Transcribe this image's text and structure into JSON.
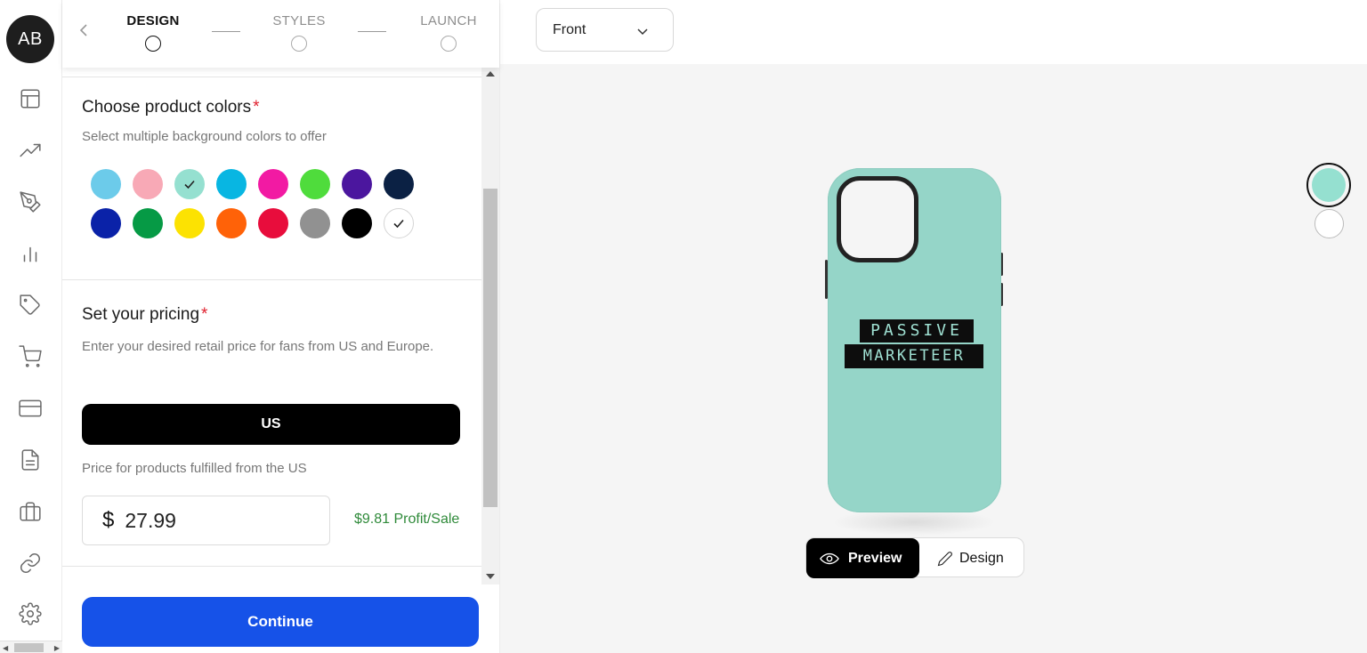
{
  "user": {
    "initials": "AB"
  },
  "nav": {
    "icons": [
      "layout-icon",
      "trending-icon",
      "pen-tool-icon",
      "bar-chart-icon",
      "tag-icon",
      "cart-icon",
      "credit-card-icon",
      "document-icon",
      "briefcase-icon",
      "link-icon",
      "settings-icon"
    ]
  },
  "stepper": {
    "steps": [
      {
        "label": "DESIGN",
        "active": true
      },
      {
        "label": "STYLES",
        "active": false
      },
      {
        "label": "LAUNCH",
        "active": false
      }
    ]
  },
  "colors_section": {
    "title": "Choose product colors",
    "required_mark": "*",
    "subtitle": "Select multiple background colors to offer",
    "swatches": [
      {
        "color": "#6ccbea",
        "selected": false
      },
      {
        "color": "#f8a9b6",
        "selected": false
      },
      {
        "color": "#95e0d0",
        "selected": true
      },
      {
        "color": "#08b6e2",
        "selected": false
      },
      {
        "color": "#f21aa3",
        "selected": false
      },
      {
        "color": "#4fdc3c",
        "selected": false
      },
      {
        "color": "#4b169e",
        "selected": false
      },
      {
        "color": "#0b2144",
        "selected": false
      },
      {
        "color": "#0a22a8",
        "selected": false
      },
      {
        "color": "#069a45",
        "selected": false
      },
      {
        "color": "#fce202",
        "selected": false
      },
      {
        "color": "#ff6208",
        "selected": false
      },
      {
        "color": "#e80d3c",
        "selected": false
      },
      {
        "color": "#919191",
        "selected": false
      },
      {
        "color": "#000000",
        "selected": false
      },
      {
        "color": "#ffffff",
        "selected": true
      }
    ]
  },
  "pricing_section": {
    "title": "Set your pricing",
    "required_mark": "*",
    "subtitle": "Enter your desired retail price for fans from US and Europe.",
    "region_button": "US",
    "region_caption": "Price for products fulfilled from the US",
    "currency_symbol": "$",
    "price_value": "27.99",
    "profit_text": "$9.81 Profit/Sale"
  },
  "footer": {
    "continue_label": "Continue"
  },
  "preview": {
    "view_select": "Front",
    "case_color": "#95d5c8",
    "print_line1": "PASSIVE",
    "print_line2": "MARKETEER",
    "toggle": {
      "preview_label": "Preview",
      "design_label": "Design",
      "active": "preview"
    },
    "color_options": [
      "#95e0d0",
      "#ffffff"
    ],
    "selected_color": "#95e0d0"
  }
}
